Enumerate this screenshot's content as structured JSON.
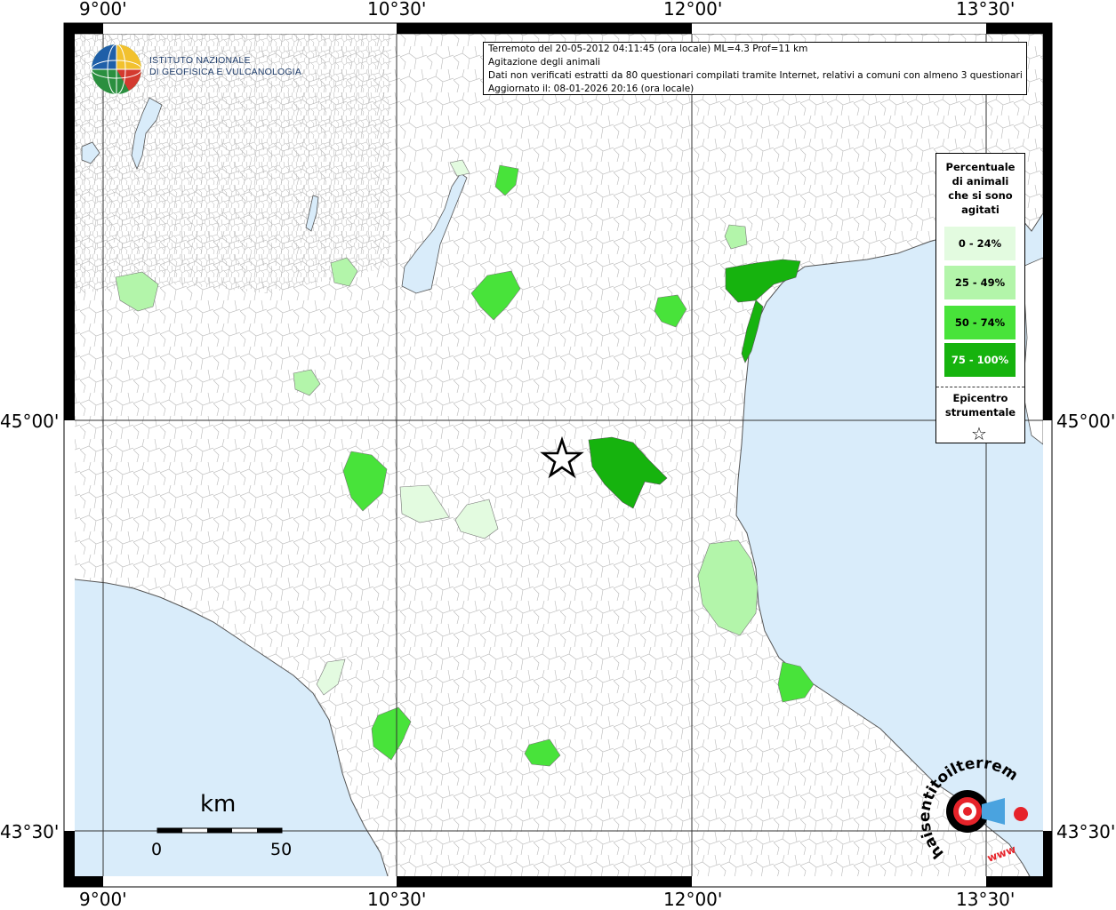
{
  "colors": {
    "sea": "#d9ecfa",
    "land": "#ffffff",
    "border": "#9a9a9a",
    "class_0_24": "#e3fbe0",
    "class_25_49": "#b3f5aa",
    "class_50_74": "#48e33a",
    "class_75_100": "#16b30e"
  },
  "map": {
    "lon_labels": [
      "9°00'",
      "10°30'",
      "12°00'",
      "13°30'"
    ],
    "lat_labels": [
      "45°00'",
      "43°30'"
    ]
  },
  "logo": {
    "icon": "ingv-globe-icon",
    "line1": "ISTITUTO NAZIONALE",
    "line2": "DI GEOFISICA E VULCANOLOGIA"
  },
  "info": {
    "line1": "Terremoto del 20-05-2012 04:11:45 (ora locale) ML=4.3 Prof=11 km",
    "line2": "Agitazione degli animali",
    "line3": "Dati non verificati estratti da 80 questionari compilati tramite Internet, relativi a comuni con almeno 3 questionari.",
    "line4": "Aggiornato il: 08-01-2026 20:16 (ora locale)"
  },
  "legend": {
    "title_lines": [
      "Percentuale",
      "di animali",
      "che si sono",
      "agitati"
    ],
    "items": [
      {
        "label": "0 - 24%",
        "color": "#e3fbe0",
        "text_color": "#000000"
      },
      {
        "label": "25 - 49%",
        "color": "#b3f5aa",
        "text_color": "#000000"
      },
      {
        "label": "50 - 74%",
        "color": "#48e33a",
        "text_color": "#000000"
      },
      {
        "label": "75 - 100%",
        "color": "#16b30e",
        "text_color": "#ffffff"
      }
    ],
    "epicenter_lines": [
      "Epicentro",
      "strumentale"
    ],
    "epicenter_icon": "star-outline-icon"
  },
  "scale": {
    "unit": "km",
    "min_label": "0",
    "max_label": "50"
  },
  "watermark": {
    "text": "haisentitoilterremoto.it",
    "sub": "www",
    "icon": "target-megaphone-icon"
  }
}
